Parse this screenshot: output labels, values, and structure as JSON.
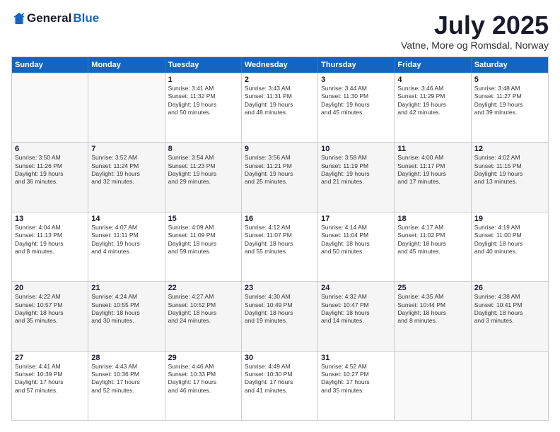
{
  "logo": {
    "general": "General",
    "blue": "Blue"
  },
  "title": "July 2025",
  "location": "Vatne, More og Romsdal, Norway",
  "headers": [
    "Sunday",
    "Monday",
    "Tuesday",
    "Wednesday",
    "Thursday",
    "Friday",
    "Saturday"
  ],
  "rows": [
    [
      {
        "day": "",
        "info": ""
      },
      {
        "day": "",
        "info": ""
      },
      {
        "day": "1",
        "info": "Sunrise: 3:41 AM\nSunset: 11:32 PM\nDaylight: 19 hours\nand 50 minutes."
      },
      {
        "day": "2",
        "info": "Sunrise: 3:43 AM\nSunset: 11:31 PM\nDaylight: 19 hours\nand 48 minutes."
      },
      {
        "day": "3",
        "info": "Sunrise: 3:44 AM\nSunset: 11:30 PM\nDaylight: 19 hours\nand 45 minutes."
      },
      {
        "day": "4",
        "info": "Sunrise: 3:46 AM\nSunset: 11:29 PM\nDaylight: 19 hours\nand 42 minutes."
      },
      {
        "day": "5",
        "info": "Sunrise: 3:48 AM\nSunset: 11:27 PM\nDaylight: 19 hours\nand 39 minutes."
      }
    ],
    [
      {
        "day": "6",
        "info": "Sunrise: 3:50 AM\nSunset: 11:26 PM\nDaylight: 19 hours\nand 36 minutes."
      },
      {
        "day": "7",
        "info": "Sunrise: 3:52 AM\nSunset: 11:24 PM\nDaylight: 19 hours\nand 32 minutes."
      },
      {
        "day": "8",
        "info": "Sunrise: 3:54 AM\nSunset: 11:23 PM\nDaylight: 19 hours\nand 29 minutes."
      },
      {
        "day": "9",
        "info": "Sunrise: 3:56 AM\nSunset: 11:21 PM\nDaylight: 19 hours\nand 25 minutes."
      },
      {
        "day": "10",
        "info": "Sunrise: 3:58 AM\nSunset: 11:19 PM\nDaylight: 19 hours\nand 21 minutes."
      },
      {
        "day": "11",
        "info": "Sunrise: 4:00 AM\nSunset: 11:17 PM\nDaylight: 19 hours\nand 17 minutes."
      },
      {
        "day": "12",
        "info": "Sunrise: 4:02 AM\nSunset: 11:15 PM\nDaylight: 19 hours\nand 13 minutes."
      }
    ],
    [
      {
        "day": "13",
        "info": "Sunrise: 4:04 AM\nSunset: 11:13 PM\nDaylight: 19 hours\nand 8 minutes."
      },
      {
        "day": "14",
        "info": "Sunrise: 4:07 AM\nSunset: 11:11 PM\nDaylight: 19 hours\nand 4 minutes."
      },
      {
        "day": "15",
        "info": "Sunrise: 4:09 AM\nSunset: 11:09 PM\nDaylight: 18 hours\nand 59 minutes."
      },
      {
        "day": "16",
        "info": "Sunrise: 4:12 AM\nSunset: 11:07 PM\nDaylight: 18 hours\nand 55 minutes."
      },
      {
        "day": "17",
        "info": "Sunrise: 4:14 AM\nSunset: 11:04 PM\nDaylight: 18 hours\nand 50 minutes."
      },
      {
        "day": "18",
        "info": "Sunrise: 4:17 AM\nSunset: 11:02 PM\nDaylight: 18 hours\nand 45 minutes."
      },
      {
        "day": "19",
        "info": "Sunrise: 4:19 AM\nSunset: 11:00 PM\nDaylight: 18 hours\nand 40 minutes."
      }
    ],
    [
      {
        "day": "20",
        "info": "Sunrise: 4:22 AM\nSunset: 10:57 PM\nDaylight: 18 hours\nand 35 minutes."
      },
      {
        "day": "21",
        "info": "Sunrise: 4:24 AM\nSunset: 10:55 PM\nDaylight: 18 hours\nand 30 minutes."
      },
      {
        "day": "22",
        "info": "Sunrise: 4:27 AM\nSunset: 10:52 PM\nDaylight: 18 hours\nand 24 minutes."
      },
      {
        "day": "23",
        "info": "Sunrise: 4:30 AM\nSunset: 10:49 PM\nDaylight: 18 hours\nand 19 minutes."
      },
      {
        "day": "24",
        "info": "Sunrise: 4:32 AM\nSunset: 10:47 PM\nDaylight: 18 hours\nand 14 minutes."
      },
      {
        "day": "25",
        "info": "Sunrise: 4:35 AM\nSunset: 10:44 PM\nDaylight: 18 hours\nand 8 minutes."
      },
      {
        "day": "26",
        "info": "Sunrise: 4:38 AM\nSunset: 10:41 PM\nDaylight: 18 hours\nand 3 minutes."
      }
    ],
    [
      {
        "day": "27",
        "info": "Sunrise: 4:41 AM\nSunset: 10:39 PM\nDaylight: 17 hours\nand 57 minutes."
      },
      {
        "day": "28",
        "info": "Sunrise: 4:43 AM\nSunset: 10:36 PM\nDaylight: 17 hours\nand 52 minutes."
      },
      {
        "day": "29",
        "info": "Sunrise: 4:46 AM\nSunset: 10:33 PM\nDaylight: 17 hours\nand 46 minutes."
      },
      {
        "day": "30",
        "info": "Sunrise: 4:49 AM\nSunset: 10:30 PM\nDaylight: 17 hours\nand 41 minutes."
      },
      {
        "day": "31",
        "info": "Sunrise: 4:52 AM\nSunset: 10:27 PM\nDaylight: 17 hours\nand 35 minutes."
      },
      {
        "day": "",
        "info": ""
      },
      {
        "day": "",
        "info": ""
      }
    ]
  ]
}
